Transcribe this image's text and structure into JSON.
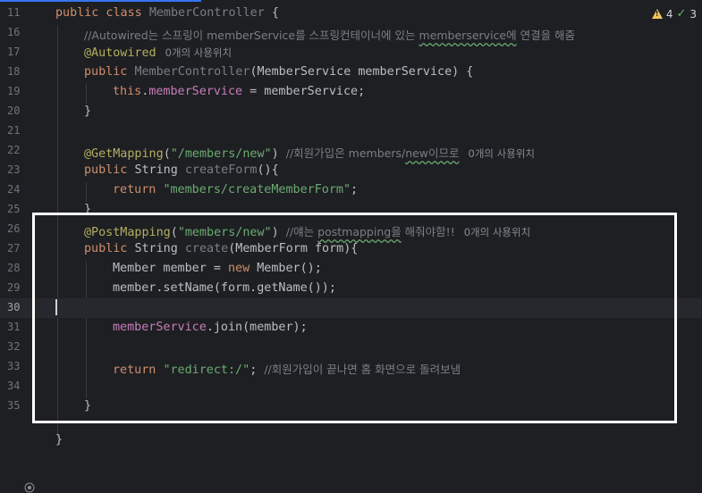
{
  "status": {
    "warnings": "4",
    "checks": "3",
    "warning_color": "#f2c55c",
    "check_color": "#5fb865"
  },
  "colors": {
    "background": "#1e1f22",
    "keyword": "#cf8e6d",
    "string": "#6aab73",
    "annotation": "#b3ae60",
    "field": "#c77dbb",
    "method": "#56a8f5"
  },
  "lines": {
    "l11": {
      "num": "11",
      "kw": "public class ",
      "grey": "MemberController",
      "rest": " {"
    },
    "l16": {
      "num": "16",
      "c1": "//Autowired는 스프링이 memberService를 스프링컨테이너에 있는 ",
      "c2": "memberservice에",
      "c3": " 연결을 해줌"
    },
    "l17": {
      "num": "17",
      "ann": "@Autowired",
      "hint": "0개의 사용위치"
    },
    "l18": {
      "num": "18",
      "kw": "public ",
      "grey": "MemberController",
      "rest": "(MemberService memberService) {"
    },
    "l19": {
      "num": "19",
      "kw": "this",
      "dot": ".",
      "fld": "memberService",
      "rest": " = memberService;"
    },
    "l20": {
      "num": "20",
      "rest": "}"
    },
    "l21": {
      "num": "21"
    },
    "l22": {
      "num": "22",
      "ann": "@GetMapping",
      "p1": "(",
      "str": "\"/members/new\"",
      "p2": ") ",
      "c1": "//회원가입은 members/",
      "c2": "new이므로",
      "hint": "0개의 사용위치"
    },
    "l23": {
      "num": "23",
      "kw": "public ",
      "type": "String ",
      "grey": "createForm",
      "rest": "(){"
    },
    "l24": {
      "num": "24",
      "kw": "return ",
      "str": "\"members/createMemberForm\"",
      "rest": ";"
    },
    "l25": {
      "num": "25",
      "rest": "}"
    },
    "l26": {
      "num": "26",
      "ann": "@PostMapping",
      "p1": "(",
      "str": "\"members/new\"",
      "p2": ") ",
      "c1": "//얘는 ",
      "c2": "postmapping을",
      "c3": " 해줘야함!!",
      "hint": "0개의 사용위치"
    },
    "l27": {
      "num": "27",
      "kw": "public ",
      "type": "String ",
      "grey": "create",
      "rest": "(MemberForm form){"
    },
    "l28": {
      "num": "28",
      "a": "Member member = ",
      "kw": "new ",
      "b": "Member();"
    },
    "l29": {
      "num": "29",
      "rest": "member.setName(form.getName());"
    },
    "l30": {
      "num": "30"
    },
    "l31": {
      "num": "31",
      "fld": "memberService",
      "rest": ".join(member);"
    },
    "l32": {
      "num": "32"
    },
    "l33": {
      "num": "33",
      "kw": "return ",
      "str": "\"redirect:/\"",
      "p": "; ",
      "c": "//회원가입이 끝나면 홈 화면으로 돌려보냄"
    },
    "l34": {
      "num": "34"
    },
    "l35": {
      "num": "35",
      "rest": "}"
    },
    "l36": {
      "rest": "}"
    }
  }
}
